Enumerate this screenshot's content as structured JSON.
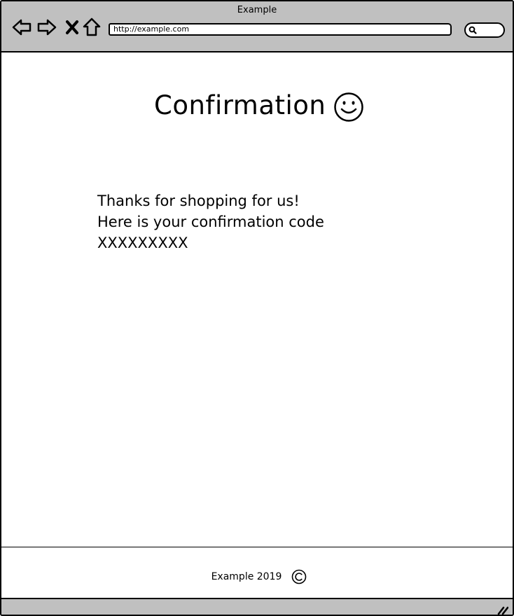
{
  "window": {
    "title": "Example"
  },
  "toolbar": {
    "back_icon": "arrow-left-icon",
    "forward_icon": "arrow-right-icon",
    "stop_icon": "close-icon",
    "home_icon": "home-icon",
    "search_icon": "search-icon"
  },
  "address_bar": {
    "url": "http://example.com"
  },
  "page": {
    "title": "Confirmation",
    "title_icon": "smiley-icon",
    "message_lines": [
      "Thanks for shopping for us!",
      "Here is your confirmation code",
      "XXXXXXXXX"
    ]
  },
  "footer": {
    "text": "Example 2019",
    "icon": "copyright-icon"
  },
  "statusbar": {
    "icon": "resize-grip-icon"
  }
}
